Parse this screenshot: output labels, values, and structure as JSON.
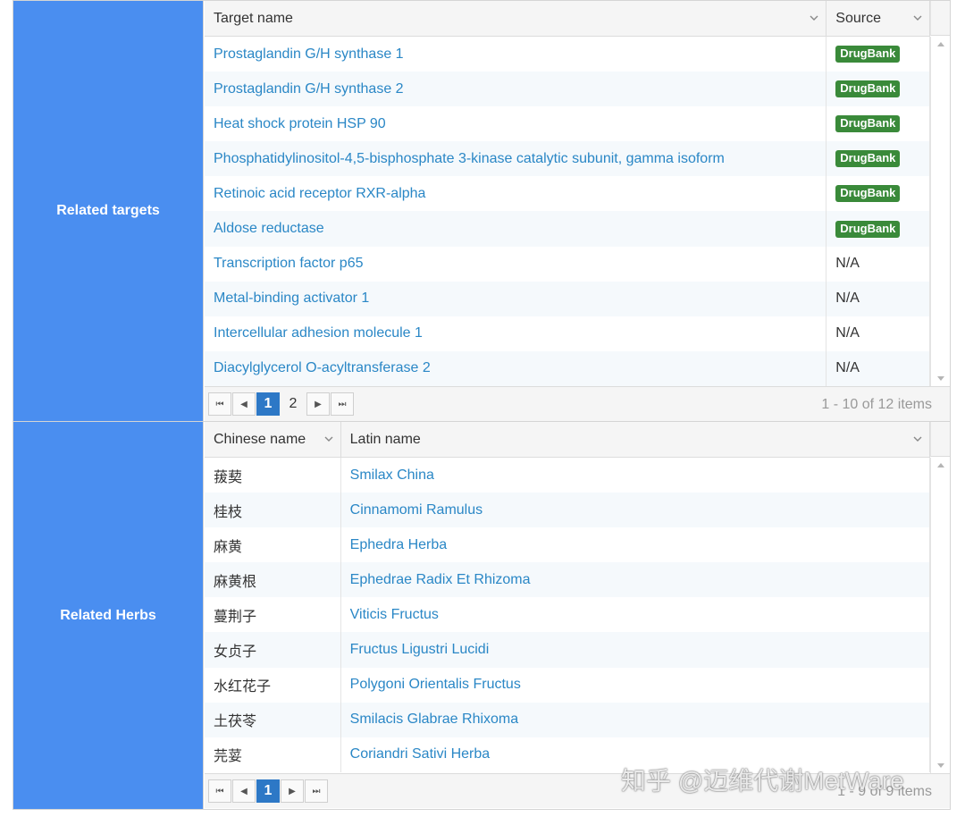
{
  "targets": {
    "label": "Related targets",
    "columns": [
      "Target name",
      "Source"
    ],
    "rows": [
      {
        "name": "Prostaglandin G/H synthase 1",
        "source": "DrugBank",
        "badge": true
      },
      {
        "name": "Prostaglandin G/H synthase 2",
        "source": "DrugBank",
        "badge": true
      },
      {
        "name": "Heat shock protein HSP 90",
        "source": "DrugBank",
        "badge": true
      },
      {
        "name": "Phosphatidylinositol-4,5-bisphosphate 3-kinase catalytic subunit, gamma isoform",
        "source": "DrugBank",
        "badge": true
      },
      {
        "name": "Retinoic acid receptor RXR-alpha",
        "source": "DrugBank",
        "badge": true
      },
      {
        "name": "Aldose reductase",
        "source": "DrugBank",
        "badge": true
      },
      {
        "name": "Transcription factor p65",
        "source": "N/A",
        "badge": false
      },
      {
        "name": "Metal-binding activator 1",
        "source": "N/A",
        "badge": false
      },
      {
        "name": "Intercellular adhesion molecule 1",
        "source": "N/A",
        "badge": false
      },
      {
        "name": "Diacylglycerol O-acyltransferase 2",
        "source": "N/A",
        "badge": false
      }
    ],
    "pager": {
      "current": "1",
      "other_page": "2",
      "info": "1 - 10 of 12 items"
    }
  },
  "herbs": {
    "label": "Related Herbs",
    "columns": [
      "Chinese name",
      "Latin name"
    ],
    "rows": [
      {
        "cn": "菝葜",
        "latin": "Smilax China"
      },
      {
        "cn": "桂枝",
        "latin": "Cinnamomi Ramulus"
      },
      {
        "cn": "麻黄",
        "latin": "Ephedra Herba"
      },
      {
        "cn": "麻黄根",
        "latin": "Ephedrae Radix Et Rhizoma"
      },
      {
        "cn": "蔓荆子",
        "latin": "Viticis Fructus"
      },
      {
        "cn": "女贞子",
        "latin": "Fructus Ligustri Lucidi"
      },
      {
        "cn": "水红花子",
        "latin": "Polygoni Orientalis Fructus"
      },
      {
        "cn": "土茯苓",
        "latin": "Smilacis Glabrae Rhixoma"
      },
      {
        "cn": "芫荽",
        "latin": "Coriandri Sativi Herba"
      }
    ],
    "pager": {
      "current": "1",
      "info": "1 - 9 of 9 items"
    }
  },
  "watermark": "知乎 @迈维代谢MetWare",
  "colors": {
    "label_bg": "#4a8ef0",
    "link": "#2a87c6",
    "badge": "#3a8a3a",
    "active_page": "#2d78c6"
  },
  "icons": {
    "first": "first-page-icon",
    "prev": "prev-page-icon",
    "next": "next-page-icon",
    "last": "last-page-icon",
    "sort": "chevron-down-icon"
  }
}
